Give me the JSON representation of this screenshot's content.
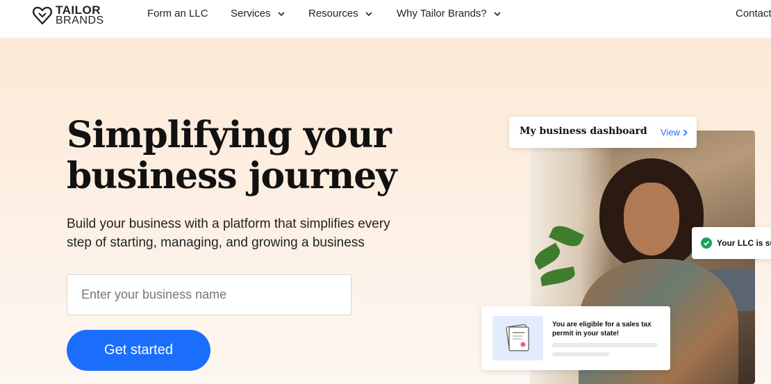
{
  "brand": {
    "line1": "TAILOR",
    "line2": "BRANDS"
  },
  "nav": {
    "items": [
      {
        "label": "Form an LLC",
        "dropdown": false
      },
      {
        "label": "Services",
        "dropdown": true
      },
      {
        "label": "Resources",
        "dropdown": true
      },
      {
        "label": "Why Tailor Brands?",
        "dropdown": true
      },
      {
        "label": "Contact",
        "dropdown": false
      }
    ]
  },
  "hero": {
    "headline_line1": "Simplifying your",
    "headline_line2": "business journey",
    "subtext_line1": "Build your business with a platform that simplifies every",
    "subtext_line2": "step of starting, managing, and growing a business",
    "input_placeholder": "Enter your business name",
    "cta_label": "Get started"
  },
  "cards": {
    "dashboard": {
      "title": "My business dashboard",
      "link": "View"
    },
    "llc": {
      "text": "Your LLC is sub"
    },
    "tax": {
      "text": "You are eligible for a sales tax permit in your state!"
    }
  },
  "colors": {
    "accent": "#1b6efb",
    "hero_bg": "#fde9d7",
    "success": "#19a35a"
  },
  "icons": {
    "logo": "heart-tag-logo-icon",
    "chevron": "chevron-down-icon",
    "check": "check-circle-icon",
    "document": "certificate-document-icon"
  }
}
